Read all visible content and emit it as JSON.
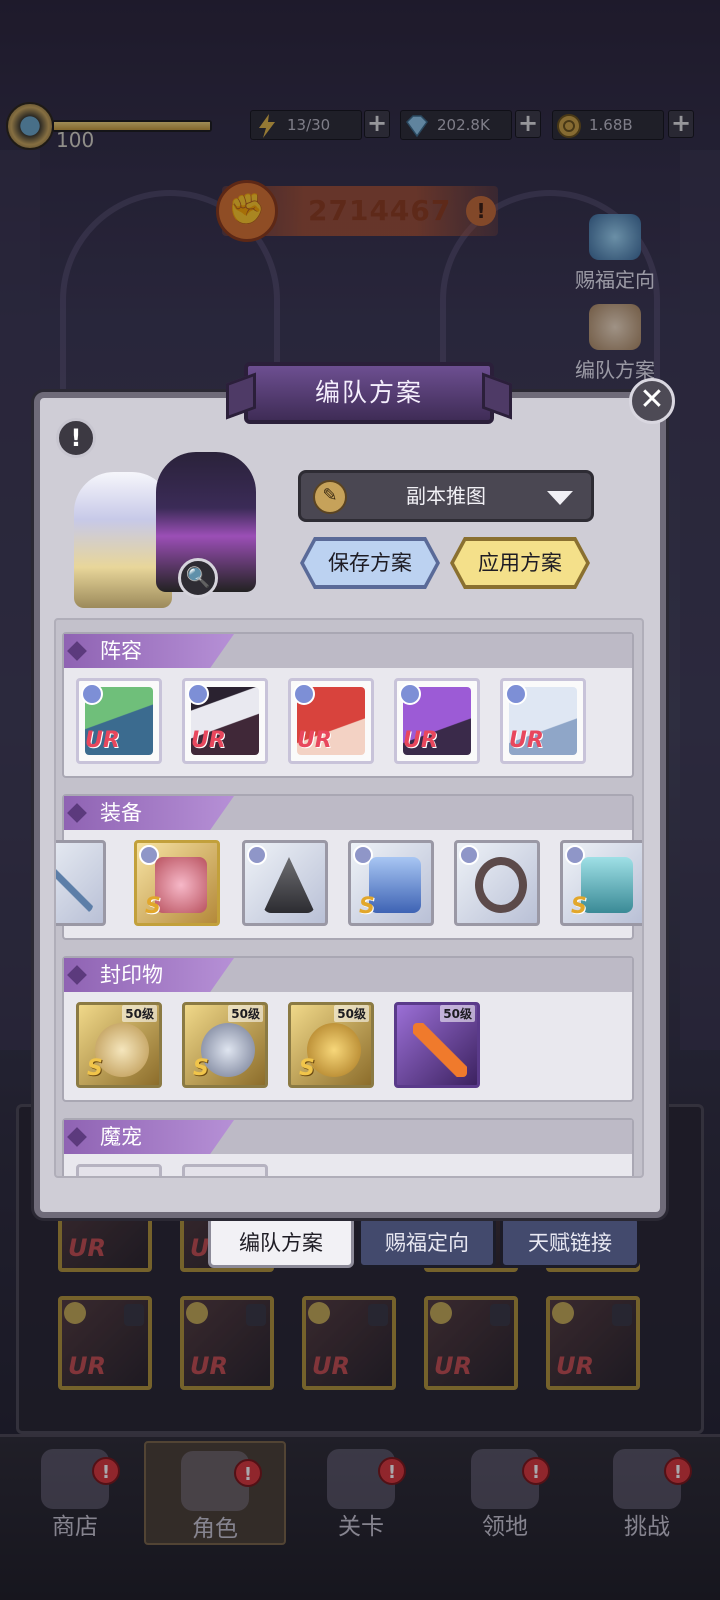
{
  "top": {
    "level": "100",
    "level_progress": 1.0,
    "resources": [
      {
        "name": "stamina",
        "icon": "lightning-icon",
        "value": "13/30"
      },
      {
        "name": "diamond",
        "icon": "diamond-icon",
        "value": "202.8K"
      },
      {
        "name": "gold",
        "icon": "coin-icon",
        "value": "1.68B"
      }
    ],
    "plus_label": "+"
  },
  "power": {
    "value": "2714467",
    "icon": "fist-icon",
    "warn": "!"
  },
  "side": {
    "blessing": "赐福定向",
    "formation": "编队方案"
  },
  "modal": {
    "title": "编队方案",
    "close": "✕",
    "info": "!",
    "zoom": "🔍",
    "dropdown": {
      "icon": "pencil-icon",
      "value": "副本推图"
    },
    "save_label": "保存方案",
    "apply_label": "应用方案",
    "sections": {
      "lineup": "阵容",
      "equipment": "装备",
      "seals": "封印物",
      "pets": "魔宠"
    },
    "heroes": [
      {
        "rarity": "UR",
        "hair": "#6fbf7a"
      },
      {
        "rarity": "UR",
        "hair": "#e9e9f0"
      },
      {
        "rarity": "UR",
        "hair": "#d8433d"
      },
      {
        "rarity": "UR",
        "hair": "#9c5bd6"
      },
      {
        "rarity": "UR",
        "hair": "#dfe7f3"
      }
    ],
    "equipment": [
      {
        "icon": "staff-icon",
        "grade": ""
      },
      {
        "icon": "lotus-book-icon",
        "grade": "S"
      },
      {
        "icon": "wizard-hat-icon",
        "grade": ""
      },
      {
        "icon": "robe-icon",
        "grade": "S"
      },
      {
        "icon": "ring-icon",
        "grade": ""
      },
      {
        "icon": "crown-icon",
        "grade": "S"
      }
    ],
    "seals": [
      {
        "icon": "puppet-icon",
        "level": "50级",
        "grade": "S"
      },
      {
        "icon": "crossed-blades-icon",
        "level": "50级",
        "grade": "S"
      },
      {
        "icon": "coin-seal-icon",
        "level": "50级",
        "grade": "S"
      },
      {
        "icon": "flame-spear-icon",
        "level": "50级",
        "grade": ""
      }
    ]
  },
  "tabs": {
    "formation": "编队方案",
    "blessing": "赐福定向",
    "talent": "天赋链接"
  },
  "roster_rarity": "UR",
  "nav": [
    {
      "label": "商店",
      "badge": "!"
    },
    {
      "label": "角色",
      "badge": "!"
    },
    {
      "label": "关卡",
      "badge": "!"
    },
    {
      "label": "领地",
      "badge": "!"
    },
    {
      "label": "挑战",
      "badge": "!"
    }
  ],
  "colors": {
    "accent_purple": "#8f63b3",
    "apply_gold": "#f4e08a",
    "save_blue": "#bcd2f1",
    "badge_red": "#d9363a"
  }
}
